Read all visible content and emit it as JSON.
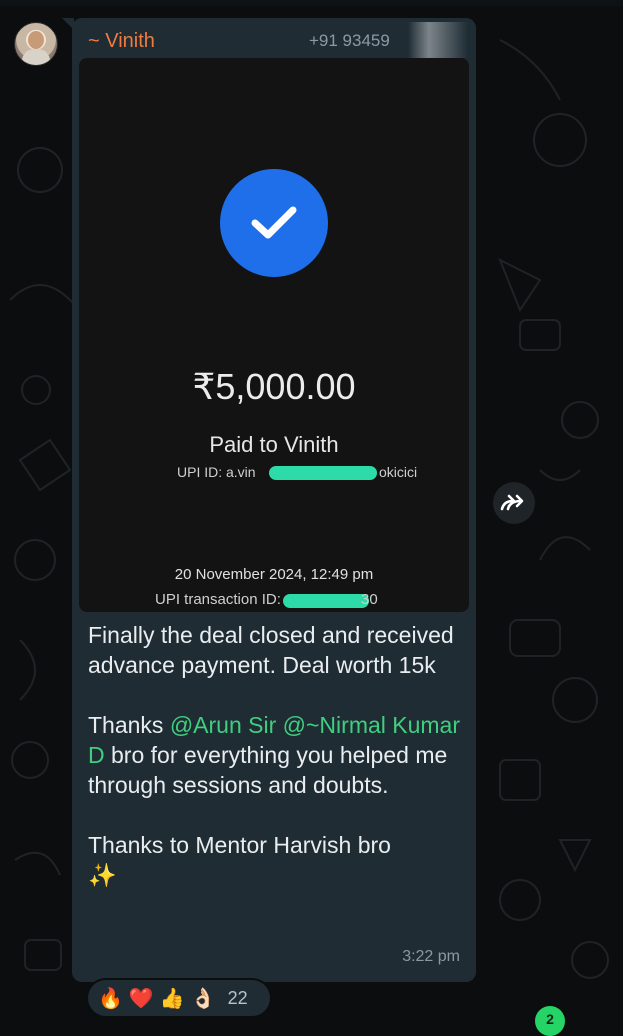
{
  "sender": {
    "name": "~ Vinith",
    "phone": "+91 93459"
  },
  "receipt": {
    "amount": "₹5,000.00",
    "paid_to": "Paid to Vinith",
    "upi_id_prefix": "UPI ID: a.vin",
    "upi_id_suffix": "okicici",
    "datetime": "20 November 2024, 12:49 pm",
    "txn_prefix": "UPI transaction ID:",
    "txn_suffix": "30"
  },
  "message": {
    "line1": "Finally the deal closed and received advance payment. Deal worth 15k",
    "thanks_prefix": "Thanks ",
    "mention1": "@Arun Sir",
    "mention2": "@~Nirmal Kumar D",
    "thanks_suffix": " bro for everything you helped me through sessions and doubts.",
    "line3": "Thanks to Mentor Harvish bro",
    "sparkles": "✨",
    "time": "3:22 pm"
  },
  "reactions": {
    "emojis": [
      "🔥",
      "❤️",
      "👍",
      "👌🏻"
    ],
    "count": "22"
  },
  "unread_badge": "2",
  "colors": {
    "bubble": "#1f2c34",
    "sender": "#f07b3f",
    "mention": "#3fcf7f",
    "check_circle": "#1f6fea",
    "background": "#0b0d0e"
  }
}
